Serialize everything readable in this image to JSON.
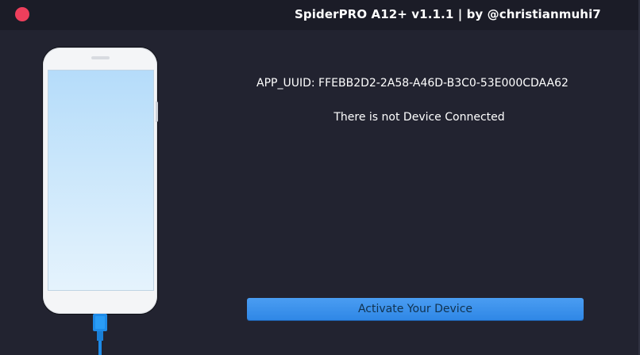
{
  "window": {
    "title": "SpiderPRO A12+ v1.1.1 | by @christianmuhi7",
    "close_icon": "close-icon"
  },
  "main": {
    "uuid_text": "APP_UUID: FFEBB2D2-2A58-A46D-B3C0-53E000CDAA62",
    "status_text": "There is not Device Connected",
    "activate_label": "Activate Your Device"
  },
  "illustration": {
    "device": "phone-icon",
    "cable": "usb-cable-icon"
  },
  "colors": {
    "background": "#222330",
    "titlebar": "#1b1c27",
    "close": "#ee3f5c",
    "accent": "#3a92ee"
  }
}
